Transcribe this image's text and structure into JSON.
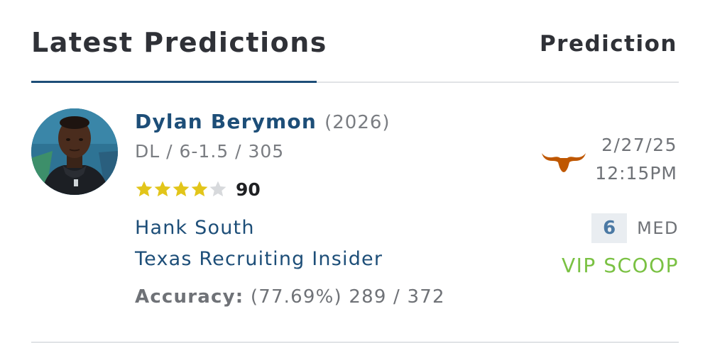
{
  "header": {
    "title": "Latest Predictions",
    "prediction_column": "Prediction"
  },
  "prediction": {
    "player": {
      "name": "Dylan Berymon",
      "class_year": "(2026)",
      "measurables": "DL / 6-1.5 / 305",
      "stars": 4,
      "max_stars": 5,
      "rating": "90"
    },
    "analyst": {
      "name": "Hank South",
      "outlet": "Texas Recruiting Insider",
      "accuracy_label": "Accuracy:",
      "accuracy_value": "(77.69%) 289 / 372"
    },
    "team_logo_icon": "texas-longhorn-icon",
    "date": "2/27/25",
    "time": "12:15PM",
    "confidence": {
      "value": "6",
      "label": "MED"
    },
    "badge": "VIP SCOOP"
  },
  "colors": {
    "brand_blue": "#1d4e78",
    "star_filled": "#e2c51a",
    "star_empty": "#d7d9dc",
    "vip_green": "#7ac143",
    "longhorn_orange": "#bf5700"
  }
}
